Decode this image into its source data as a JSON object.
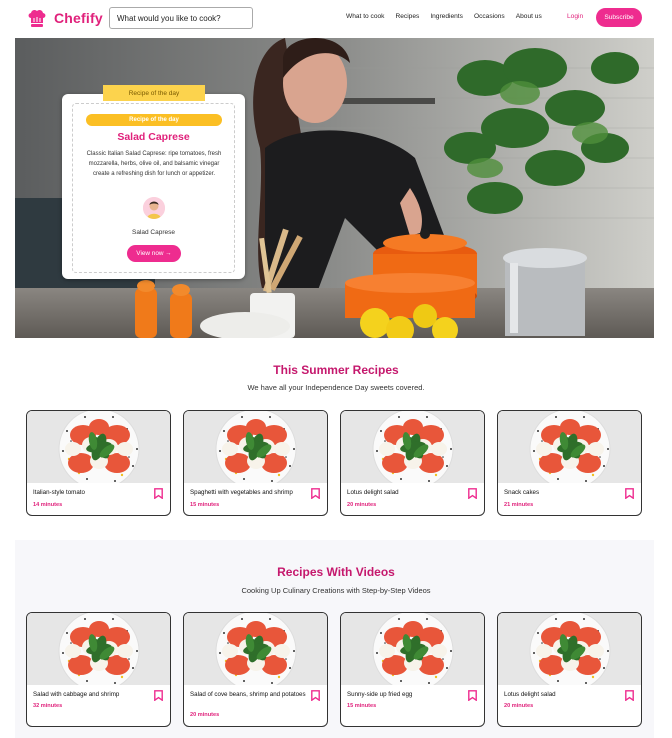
{
  "brand": {
    "name": "Chefify",
    "accent": "#e0217b"
  },
  "search": {
    "placeholder": "What would you like to cook?"
  },
  "nav": {
    "items": [
      "What to cook",
      "Recipes",
      "Ingredients",
      "Occasions",
      "About us"
    ]
  },
  "auth": {
    "login": "Login",
    "subscribe": "Subscribe"
  },
  "recipe_of_day": {
    "tab": "Recipe of the day",
    "badge": "Recipe of the day",
    "title": "Salad Caprese",
    "description": "Classic Italian Salad Caprese: ripe tomatoes, fresh mozzarella, herbs, olive oil, and balsamic vinegar create a refreshing dish for lunch or appetizer.",
    "author": "Salad Caprese",
    "button": "View now →"
  },
  "summer": {
    "title": "This Summer Recipes",
    "subtitle": "We have all your Independence Day sweets covered.",
    "cards": [
      {
        "title": "Italian-style tomato",
        "time": "14 minutes"
      },
      {
        "title": "Spaghetti with vegetables and shrimp",
        "time": "15 minutes"
      },
      {
        "title": "Lotus delight salad",
        "time": "20 minutes"
      },
      {
        "title": "Snack cakes",
        "time": "21 minutes"
      }
    ]
  },
  "videos": {
    "title": "Recipes With Videos",
    "subtitle": "Cooking Up Culinary Creations with Step-by-Step Videos",
    "cards": [
      {
        "title": "Salad with cabbage and shrimp",
        "time": "32 minutes"
      },
      {
        "title": "Salad of cove beans, shrimp and potatoes",
        "time": "20 minutes"
      },
      {
        "title": "Sunny-side up fried egg",
        "time": "15 minutes"
      },
      {
        "title": "Lotus delight salad",
        "time": "20 minutes"
      }
    ]
  },
  "icons": [
    "chef-hat-icon",
    "bookmark-icon",
    "avatar-icon"
  ]
}
